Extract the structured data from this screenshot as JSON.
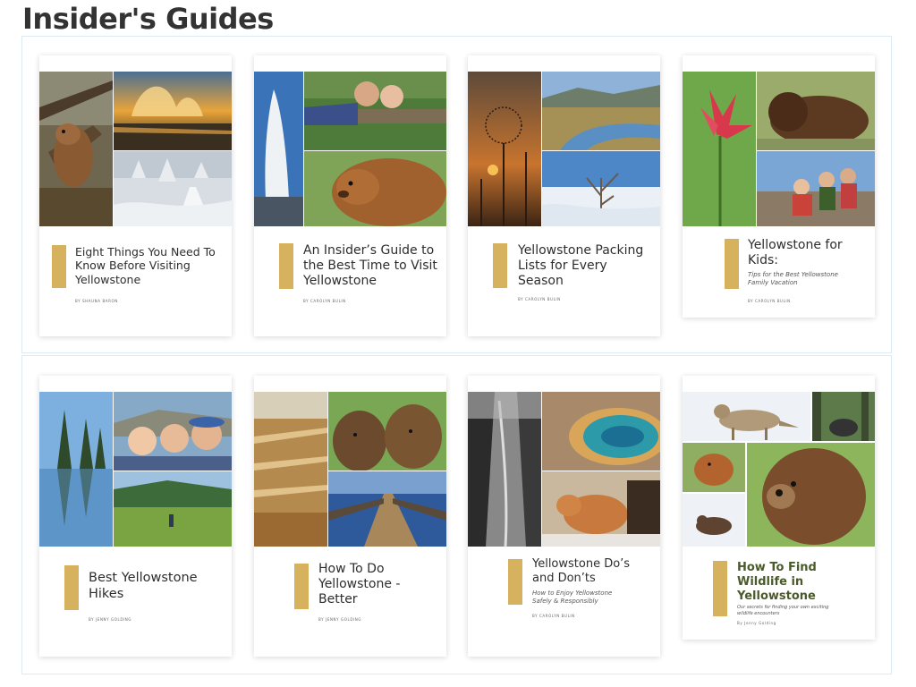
{
  "page": {
    "title": "Insider's Guides"
  },
  "guides": [
    {
      "title": "Eight Things You Need To Know Before Visiting Yellowstone",
      "byline": "BY SHAUNA BARON"
    },
    {
      "title": "An Insider’s Guide to the Best Time to Visit Yellowstone",
      "byline": "BY CAROLYN BULIN"
    },
    {
      "title": "Yellowstone Packing Lists for Every Season",
      "byline": "BY CAROLYN BULIN"
    },
    {
      "title": "Yellowstone for Kids:",
      "subtitle": "Tips for the Best Yellowstone Family Vacation",
      "byline": "BY CAROLYN BULIN"
    },
    {
      "title": "Best Yellowstone Hikes",
      "byline": "BY JENNY GOLDING"
    },
    {
      "title": "How To Do Yellowstone - Better",
      "byline": "BY JENNY GOLDING"
    },
    {
      "title": "Yellowstone Do’s and Don’ts",
      "subtitle": "How to Enjoy Yellowstone Safely & Responsibly",
      "byline": "BY CAROLYN BULIN"
    },
    {
      "title": "How To Find Wildlife in Yellowstone",
      "subtitle": "Our secrets for finding your own exciting wildlife encounters",
      "byline": "By Jenny Golding"
    }
  ],
  "colors": {
    "accent_gold": "#d6b25e",
    "border": "#dceaf6",
    "title_text": "#333333",
    "wildlife_title": "#4b5a2a"
  }
}
